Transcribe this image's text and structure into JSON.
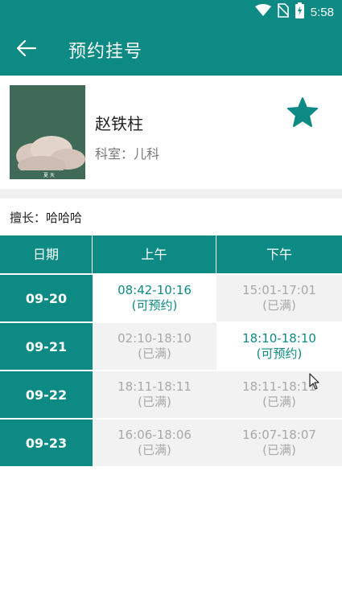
{
  "status_bar": {
    "time": "5:58",
    "icons": [
      "wifi-icon",
      "no-sim-icon",
      "battery-charging-icon"
    ]
  },
  "toolbar": {
    "title": "预约挂号",
    "back_icon": "arrow-left-icon"
  },
  "doctor": {
    "name": "赵铁柱",
    "department": "科室：儿科",
    "favorite_icon": "star-icon",
    "photo_caption": "夏 天"
  },
  "specialty": "擅长：哈哈哈",
  "schedule": {
    "headers": {
      "date": "日期",
      "am": "上午",
      "pm": "下午"
    },
    "rows": [
      {
        "date": "09-20",
        "am": {
          "time": "08:42-10:16",
          "status": "(可预约)"
        },
        "pm": {
          "time": "15:01-17:01",
          "status": "(已满)"
        }
      },
      {
        "date": "09-21",
        "am": {
          "time": "02:10-18:10",
          "status": "(已满)"
        },
        "pm": {
          "time": "18:10-18:10",
          "status": "(可预约)"
        }
      },
      {
        "date": "09-22",
        "am": {
          "time": "18:11-18:11",
          "status": "(已满)"
        },
        "pm": {
          "time": "18:11-18:11",
          "status": "(已满)"
        }
      },
      {
        "date": "09-23",
        "am": {
          "time": "16:06-18:06",
          "status": "(已满)"
        },
        "pm": {
          "time": "16:07-18:07",
          "status": "(已满)"
        }
      }
    ]
  },
  "colors": {
    "primary": "#0e8a84",
    "full_bg": "#f2f2f2",
    "full_text": "#a8a8a8"
  }
}
